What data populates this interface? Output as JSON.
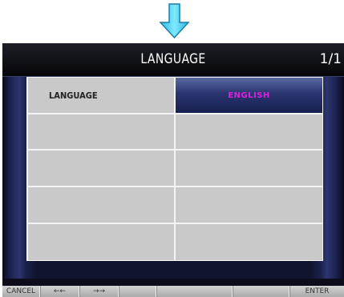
{
  "screen": {
    "title": "LANGUAGE",
    "page_indicator": "1/1"
  },
  "settings": {
    "rows": [
      {
        "label": "LANGUAGE",
        "value": "ENGLISH"
      },
      {
        "label": "",
        "value": ""
      },
      {
        "label": "",
        "value": ""
      },
      {
        "label": "",
        "value": ""
      },
      {
        "label": "",
        "value": ""
      }
    ]
  },
  "softkeys": {
    "cancel": "CANCEL",
    "prev": "←←",
    "next": "→→",
    "key4": "",
    "key5": "",
    "key6": "",
    "enter": "ENTER"
  },
  "colors": {
    "value_text": "#e020e0",
    "selected_cell": "#2a3470",
    "cell": "#c9c9c9",
    "arrow": "#55d6f0"
  },
  "icons": {
    "indicator": "down-arrow-icon"
  }
}
